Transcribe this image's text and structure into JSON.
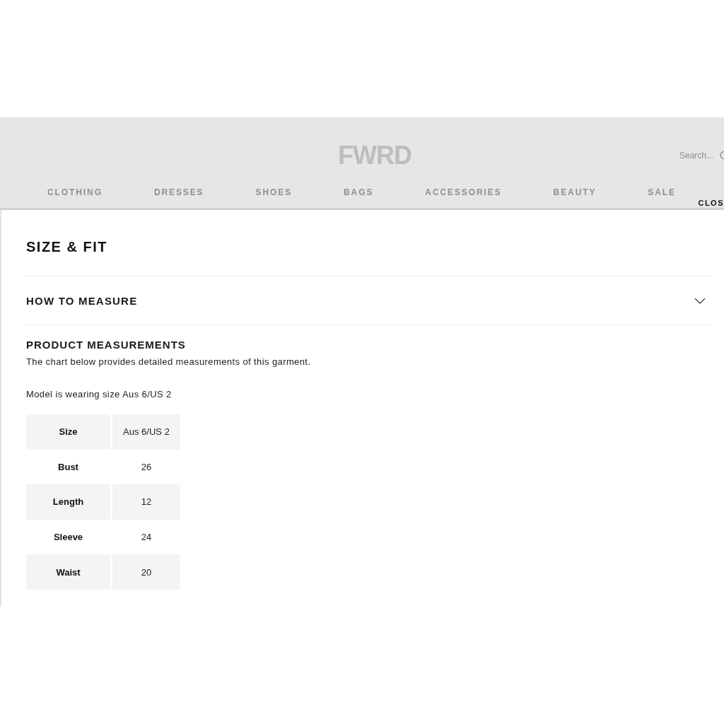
{
  "header": {
    "logo": "FWRD",
    "search": {
      "placeholder": "Search..."
    },
    "nav": [
      "CLOTHING",
      "DRESSES",
      "SHOES",
      "BAGS",
      "ACCESSORIES",
      "BEAUTY",
      "SALE"
    ],
    "close_button": "CLOS"
  },
  "panel": {
    "title": "SIZE & FIT",
    "accordion": {
      "label": "HOW TO MEASURE",
      "expanded": false
    },
    "section": {
      "title": "PRODUCT MEASUREMENTS",
      "description": "The chart below provides detailed measurements of this garment.",
      "model_note": "Model is wearing size Aus 6/US 2",
      "table": {
        "rows": [
          {
            "label": "Size",
            "value": "Aus 6/US 2"
          },
          {
            "label": "Bust",
            "value": "26"
          },
          {
            "label": "Length",
            "value": "12"
          },
          {
            "label": "Sleeve",
            "value": "24"
          },
          {
            "label": "Waist",
            "value": "20"
          }
        ]
      }
    }
  }
}
